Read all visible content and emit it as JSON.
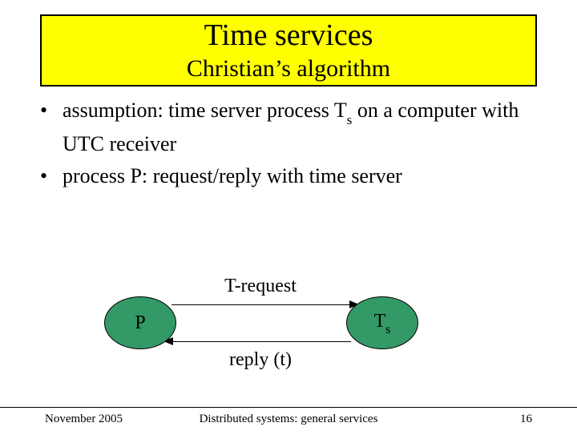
{
  "header": {
    "title": "Time services",
    "subtitle": "Christian’s algorithm"
  },
  "bullets": [
    {
      "pre": "assumption: time server process T",
      "sub": "s",
      "post": " on a computer with UTC receiver"
    },
    {
      "pre": "process P: request/reply with time server",
      "sub": "",
      "post": ""
    }
  ],
  "diagram": {
    "node_p": "P",
    "node_ts_base": "T",
    "node_ts_sub": "s",
    "top_label": "T-request",
    "bottom_label": "reply (t)"
  },
  "footer": {
    "date": "November 2005",
    "center": "Distributed systems: general services",
    "page": "16"
  },
  "chart_data": {
    "type": "diagram",
    "nodes": [
      {
        "id": "P",
        "label": "P"
      },
      {
        "id": "Ts",
        "label": "Ts"
      }
    ],
    "edges": [
      {
        "from": "P",
        "to": "Ts",
        "label": "T-request"
      },
      {
        "from": "Ts",
        "to": "P",
        "label": "reply (t)"
      }
    ]
  }
}
